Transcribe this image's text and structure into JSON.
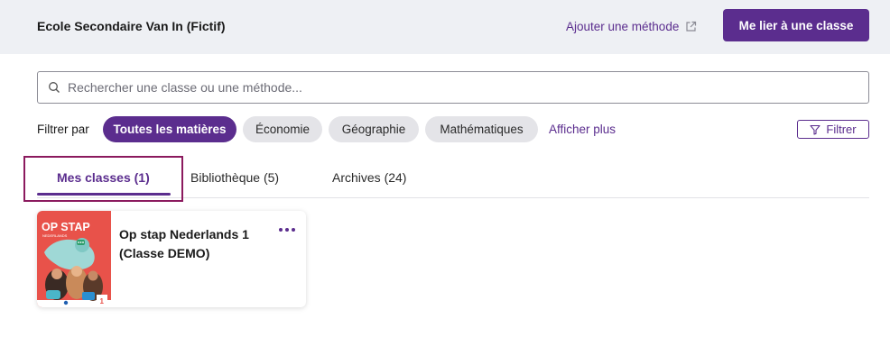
{
  "header": {
    "school_name": "Ecole Secondaire Van In (Fictif)",
    "add_method_label": "Ajouter une méthode",
    "link_class_label": "Me lier à une classe"
  },
  "search": {
    "placeholder": "Rechercher une classe ou une méthode..."
  },
  "filters": {
    "label": "Filtrer par",
    "chips": [
      {
        "label": "Toutes les matières",
        "active": true
      },
      {
        "label": "Économie",
        "active": false
      },
      {
        "label": "Géographie",
        "active": false
      },
      {
        "label": "Mathématiques",
        "active": false
      }
    ],
    "show_more_label": "Afficher plus",
    "filter_button_label": "Filtrer"
  },
  "tabs": [
    {
      "label": "Mes classes (1)",
      "active": true
    },
    {
      "label": "Bibliothèque (5)",
      "active": false
    },
    {
      "label": "Archives (24)",
      "active": false
    }
  ],
  "classes": [
    {
      "title": "Op stap Nederlands 1 (Classe DEMO)",
      "cover_text": "OP STAP",
      "cover_subtext": "NEDERLANDS",
      "cover_number": "1"
    }
  ],
  "colors": {
    "brand": "#5b2d8e",
    "header_bg": "#eef0f4",
    "cover_red": "#e8524a",
    "focus_outline": "#8b1a5e"
  },
  "icons": {
    "external_link": "external-link-icon",
    "search": "search-icon",
    "filter": "filter-icon",
    "more": "more-options-icon"
  }
}
